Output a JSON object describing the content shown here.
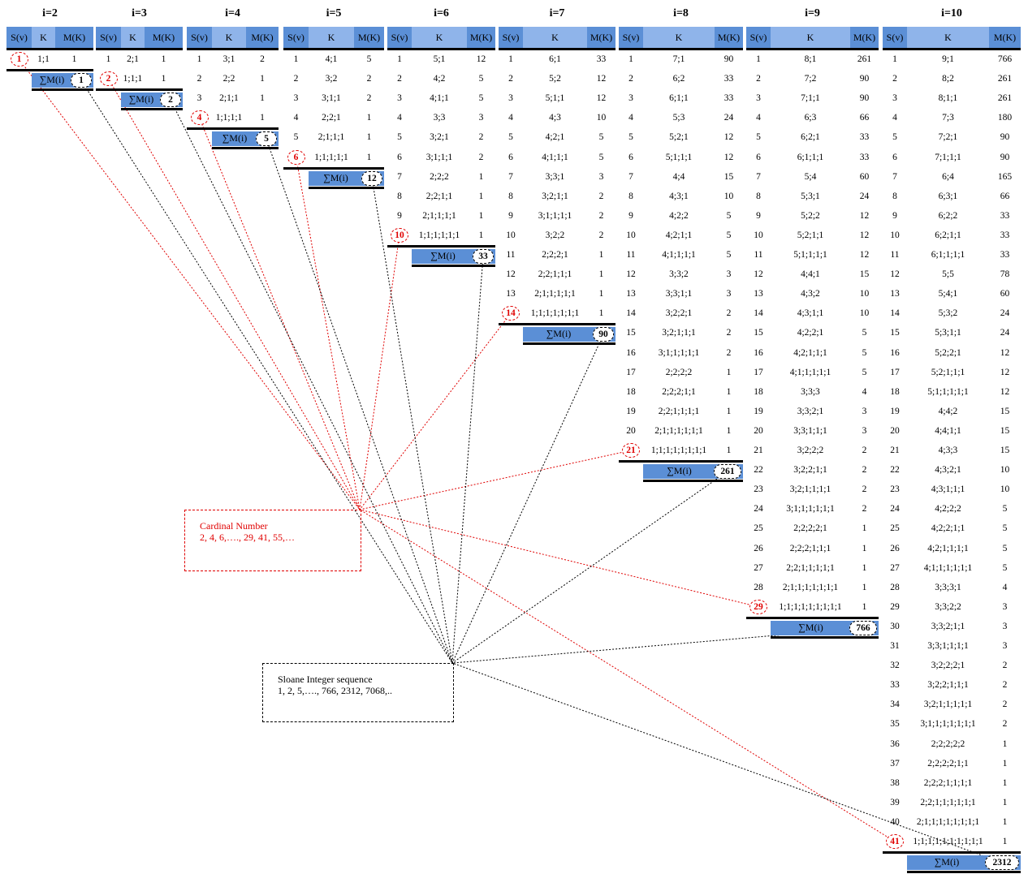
{
  "panels": [
    {
      "title": "i=2",
      "headers": [
        "S(v)",
        "K",
        "M(K)"
      ],
      "sum_label": "∑M(i)",
      "sum": "1",
      "cardinal": "1",
      "rows": [
        [
          "1",
          "1;1",
          "1"
        ]
      ]
    },
    {
      "title": "i=3",
      "headers": [
        "S(v)",
        "K",
        "M(K)"
      ],
      "sum_label": "∑M(i)",
      "sum": "2",
      "cardinal": "2",
      "rows": [
        [
          "1",
          "2;1",
          "1"
        ],
        [
          "2",
          "1;1;1",
          "1"
        ]
      ]
    },
    {
      "title": "i=4",
      "headers": [
        "S(v)",
        "K",
        "M(K)"
      ],
      "sum_label": "∑M(i)",
      "sum": "5",
      "cardinal": "4",
      "rows": [
        [
          "1",
          "3;1",
          "2"
        ],
        [
          "2",
          "2;2",
          "1"
        ],
        [
          "3",
          "2;1;1",
          "1"
        ],
        [
          "4",
          "1;1;1;1",
          "1"
        ]
      ]
    },
    {
      "title": "i=5",
      "headers": [
        "S(v)",
        "K",
        "M(K)"
      ],
      "sum_label": "∑M(i)",
      "sum": "12",
      "cardinal": "6",
      "rows": [
        [
          "1",
          "4;1",
          "5"
        ],
        [
          "2",
          "3;2",
          "2"
        ],
        [
          "3",
          "3;1;1",
          "2"
        ],
        [
          "4",
          "2;2;1",
          "1"
        ],
        [
          "5",
          "2;1;1;1",
          "1"
        ],
        [
          "6",
          "1;1;1;1;1",
          "1"
        ]
      ]
    },
    {
      "title": "i=6",
      "headers": [
        "S(v)",
        "K",
        "M(K)"
      ],
      "sum_label": "∑M(i)",
      "sum": "33",
      "cardinal": "10",
      "rows": [
        [
          "1",
          "5;1",
          "12"
        ],
        [
          "2",
          "4;2",
          "5"
        ],
        [
          "3",
          "4;1;1",
          "5"
        ],
        [
          "4",
          "3;3",
          "3"
        ],
        [
          "5",
          "3;2;1",
          "2"
        ],
        [
          "6",
          "3;1;1;1",
          "2"
        ],
        [
          "7",
          "2;2;2",
          "1"
        ],
        [
          "8",
          "2;2;1;1",
          "1"
        ],
        [
          "9",
          "2;1;1;1;1",
          "1"
        ],
        [
          "10",
          "1;1;1;1;1;1",
          "1"
        ]
      ]
    },
    {
      "title": "i=7",
      "headers": [
        "S(v)",
        "K",
        "M(K)"
      ],
      "sum_label": "∑M(i)",
      "sum": "90",
      "cardinal": "14",
      "rows": [
        [
          "1",
          "6;1",
          "33"
        ],
        [
          "2",
          "5;2",
          "12"
        ],
        [
          "3",
          "5;1;1",
          "12"
        ],
        [
          "4",
          "4;3",
          "10"
        ],
        [
          "5",
          "4;2;1",
          "5"
        ],
        [
          "6",
          "4;1;1;1",
          "5"
        ],
        [
          "7",
          "3;3;1",
          "3"
        ],
        [
          "8",
          "3;2;1;1",
          "2"
        ],
        [
          "9",
          "3;1;1;1;1",
          "2"
        ],
        [
          "10",
          "3;2;2",
          "2"
        ],
        [
          "11",
          "2;2;2;1",
          "1"
        ],
        [
          "12",
          "2;2;1;1;1",
          "1"
        ],
        [
          "13",
          "2;1;1;1;1;1",
          "1"
        ],
        [
          "14",
          "1;1;1;1;1;1;1",
          "1"
        ]
      ]
    },
    {
      "title": "i=8",
      "headers": [
        "S(v)",
        "K",
        "M(K)"
      ],
      "sum_label": "∑M(i)",
      "sum": "261",
      "cardinal": "21",
      "rows": [
        [
          "1",
          "7;1",
          "90"
        ],
        [
          "2",
          "6;2",
          "33"
        ],
        [
          "3",
          "6;1;1",
          "33"
        ],
        [
          "4",
          "5;3",
          "24"
        ],
        [
          "5",
          "5;2;1",
          "12"
        ],
        [
          "6",
          "5;1;1;1",
          "12"
        ],
        [
          "7",
          "4;4",
          "15"
        ],
        [
          "8",
          "4;3;1",
          "10"
        ],
        [
          "9",
          "4;2;2",
          "5"
        ],
        [
          "10",
          "4;2;1;1",
          "5"
        ],
        [
          "11",
          "4;1;1;1;1",
          "5"
        ],
        [
          "12",
          "3;3;2",
          "3"
        ],
        [
          "13",
          "3;3;1;1",
          "3"
        ],
        [
          "14",
          "3;2;2;1",
          "2"
        ],
        [
          "15",
          "3;2;1;1;1",
          "2"
        ],
        [
          "16",
          "3;1;1;1;1;1",
          "2"
        ],
        [
          "17",
          "2;2;2;2",
          "1"
        ],
        [
          "18",
          "2;2;2;1;1",
          "1"
        ],
        [
          "19",
          "2;2;1;1;1;1",
          "1"
        ],
        [
          "20",
          "2;1;1;1;1;1;1",
          "1"
        ],
        [
          "21",
          "1;1;1;1;1;1;1;1",
          "1"
        ]
      ]
    },
    {
      "title": "i=9",
      "headers": [
        "S(v)",
        "K",
        "M(K)"
      ],
      "sum_label": "∑M(i)",
      "sum": "766",
      "cardinal": "29",
      "rows": [
        [
          "1",
          "8;1",
          "261"
        ],
        [
          "2",
          "7;2",
          "90"
        ],
        [
          "3",
          "7;1;1",
          "90"
        ],
        [
          "4",
          "6;3",
          "66"
        ],
        [
          "5",
          "6;2;1",
          "33"
        ],
        [
          "6",
          "6;1;1;1",
          "33"
        ],
        [
          "7",
          "5;4",
          "60"
        ],
        [
          "8",
          "5;3;1",
          "24"
        ],
        [
          "9",
          "5;2;2",
          "12"
        ],
        [
          "10",
          "5;2;1;1",
          "12"
        ],
        [
          "11",
          "5;1;1;1;1",
          "12"
        ],
        [
          "12",
          "4;4;1",
          "15"
        ],
        [
          "13",
          "4;3;2",
          "10"
        ],
        [
          "14",
          "4;3;1;1",
          "10"
        ],
        [
          "15",
          "4;2;2;1",
          "5"
        ],
        [
          "16",
          "4;2;1;1;1",
          "5"
        ],
        [
          "17",
          "4;1;1;1;1;1",
          "5"
        ],
        [
          "18",
          "3;3;3",
          "4"
        ],
        [
          "19",
          "3;3;2;1",
          "3"
        ],
        [
          "20",
          "3;3;1;1;1",
          "3"
        ],
        [
          "21",
          "3;2;2;2",
          "2"
        ],
        [
          "22",
          "3;2;2;1;1",
          "2"
        ],
        [
          "23",
          "3;2;1;1;1;1",
          "2"
        ],
        [
          "24",
          "3;1;1;1;1;1;1",
          "2"
        ],
        [
          "25",
          "2;2;2;2;1",
          "1"
        ],
        [
          "26",
          "2;2;2;1;1;1",
          "1"
        ],
        [
          "27",
          "2;2;1;1;1;1;1",
          "1"
        ],
        [
          "28",
          "2;1;1;1;1;1;1;1",
          "1"
        ],
        [
          "29",
          "1;1;1;1;1;1;1;1;1",
          "1"
        ]
      ]
    },
    {
      "title": "i=10",
      "headers": [
        "S(v)",
        "K",
        "M(K)"
      ],
      "sum_label": "∑M(i)",
      "sum": "2312",
      "cardinal": "41",
      "rows": [
        [
          "1",
          "9;1",
          "766"
        ],
        [
          "2",
          "8;2",
          "261"
        ],
        [
          "3",
          "8;1;1",
          "261"
        ],
        [
          "4",
          "7;3",
          "180"
        ],
        [
          "5",
          "7;2;1",
          "90"
        ],
        [
          "6",
          "7;1;1;1",
          "90"
        ],
        [
          "7",
          "6;4",
          "165"
        ],
        [
          "8",
          "6;3;1",
          "66"
        ],
        [
          "9",
          "6;2;2",
          "33"
        ],
        [
          "10",
          "6;2;1;1",
          "33"
        ],
        [
          "11",
          "6;1;1;1;1",
          "33"
        ],
        [
          "12",
          "5;5",
          "78"
        ],
        [
          "13",
          "5;4;1",
          "60"
        ],
        [
          "14",
          "5;3;2",
          "24"
        ],
        [
          "15",
          "5;3;1;1",
          "24"
        ],
        [
          "16",
          "5;2;2;1",
          "12"
        ],
        [
          "17",
          "5;2;1;1;1",
          "12"
        ],
        [
          "18",
          "5;1;1;1;1;1",
          "12"
        ],
        [
          "19",
          "4;4;2",
          "15"
        ],
        [
          "20",
          "4;4;1;1",
          "15"
        ],
        [
          "21",
          "4;3;3",
          "15"
        ],
        [
          "22",
          "4;3;2;1",
          "10"
        ],
        [
          "23",
          "4;3;1;1;1",
          "10"
        ],
        [
          "24",
          "4;2;2;2",
          "5"
        ],
        [
          "25",
          "4;2;2;1;1",
          "5"
        ],
        [
          "26",
          "4;2;1;1;1;1",
          "5"
        ],
        [
          "27",
          "4;1;1;1;1;1;1",
          "5"
        ],
        [
          "28",
          "3;3;3;1",
          "4"
        ],
        [
          "29",
          "3;3;2;2",
          "3"
        ],
        [
          "30",
          "3;3;2;1;1",
          "3"
        ],
        [
          "31",
          "3;3;1;1;1;1",
          "3"
        ],
        [
          "32",
          "3;2;2;2;1",
          "2"
        ],
        [
          "33",
          "3;2;2;1;1;1",
          "2"
        ],
        [
          "34",
          "3;2;1;1;1;1;1",
          "2"
        ],
        [
          "35",
          "3;1;1;1;1;1;1;1",
          "2"
        ],
        [
          "36",
          "2;2;2;2;2",
          "1"
        ],
        [
          "37",
          "2;2;2;2;1;1",
          "1"
        ],
        [
          "38",
          "2;2;2;1;1;1;1",
          "1"
        ],
        [
          "39",
          "2;2;1;1;1;1;1;1",
          "1"
        ],
        [
          "40",
          "2;1;1;1;1;1;1;1;1",
          "1"
        ],
        [
          "41",
          "1;1;1;1;1;1;1;1;1;1",
          "1"
        ]
      ]
    }
  ],
  "legends": {
    "cardinal": {
      "title": "Cardinal Number",
      "text": "2, 4, 6,…., 29, 41, 55,…"
    },
    "sloane": {
      "title": "Sloane Integer sequence",
      "text": "1, 2, 5,…., 766, 2312, 7068,.."
    }
  },
  "colors": {
    "header": "#5b8fd6",
    "header_k": "#8fb4ea",
    "cardinal_line": "#e00000",
    "sloane_line": "#000000"
  }
}
